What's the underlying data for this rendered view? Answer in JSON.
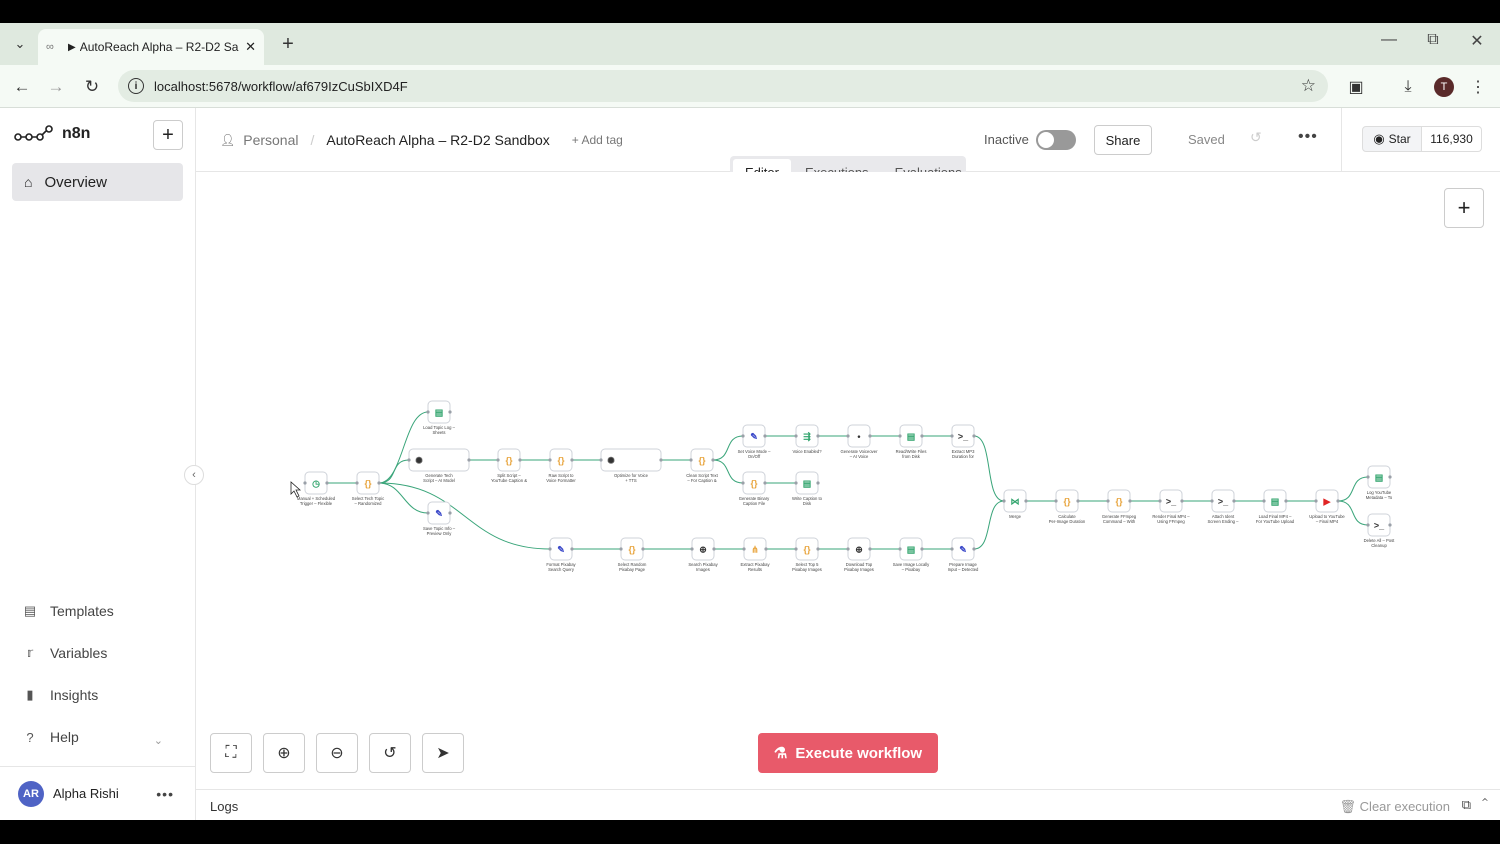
{
  "browser": {
    "tab_title": "AutoReach Alpha – R2-D2 Sa",
    "url": "localhost:5678/workflow/af679IzCuSbIXD4F",
    "profile_initial": "T"
  },
  "sidebar": {
    "brand": "n8n",
    "overview": "Overview",
    "templates": "Templates",
    "variables": "Variables",
    "insights": "Insights",
    "help": "Help",
    "user_name": "Alpha Rishi",
    "user_initials": "AR"
  },
  "header": {
    "project": "Personal",
    "workflow_name": "AutoReach Alpha – R2-D2 Sandbox",
    "add_tag": "+ Add tag",
    "status": "Inactive",
    "share": "Share",
    "saved": "Saved"
  },
  "github": {
    "star": "Star",
    "count": "116,930"
  },
  "view_tabs": [
    "Editor",
    "Executions",
    "Evaluations"
  ],
  "canvas": {
    "execute": "Execute workflow"
  },
  "logs": {
    "label": "Logs",
    "clear": "Clear execution"
  },
  "colors": {
    "accent": "#e85a6a",
    "edge": "#3aa57a",
    "node_border": "#cfd3da"
  },
  "nodes": [
    {
      "id": "trigger",
      "icon": "clock",
      "label": "Manual + Scheduled Trigger – Flexible Timing",
      "color": "#2fa36b"
    },
    {
      "id": "select_topic",
      "icon": "code",
      "label": "Select Tech Topic – Randomized",
      "color": "#e8a33a"
    },
    {
      "id": "load_log",
      "icon": "sheet",
      "label": "Load Topic Log – Sheets",
      "color": "#2fa36b"
    },
    {
      "id": "gen_script",
      "icon": "ai",
      "label": "Generate Tech Script – AI Model",
      "color": "#333333"
    },
    {
      "id": "save_topic",
      "icon": "edit",
      "label": "Save Topic Info – Preview Only",
      "color": "#3b49c9"
    },
    {
      "id": "split_script",
      "icon": "code",
      "label": "Split Script – YouTube Caption & Hashtags",
      "color": "#e8a33a"
    },
    {
      "id": "raw_script",
      "icon": "code",
      "label": "Raw Script to Voice Formatter",
      "color": "#e8a33a"
    },
    {
      "id": "optimize",
      "icon": "ai",
      "label": "Optimize for Voice + TTS",
      "color": "#333333"
    },
    {
      "id": "clean_script",
      "icon": "code",
      "label": "Clean Script Text – For Caption & Voice",
      "color": "#e8a33a"
    },
    {
      "id": "voice_mode",
      "icon": "edit",
      "label": "Set Voice Mode – On/Off",
      "color": "#3b49c9"
    },
    {
      "id": "voice_enabled",
      "icon": "switch",
      "label": "Voice Enabled?",
      "color": "#2fa36b"
    },
    {
      "id": "gen_voice",
      "icon": "dot",
      "label": "Generate Voiceover – AI Voice",
      "color": "#333333"
    },
    {
      "id": "read_wav",
      "icon": "sheet",
      "label": "Read/Write Files from Disk",
      "color": "#2fa36b"
    },
    {
      "id": "extract_mp3",
      "icon": "term",
      "label": "Extract MP3 Duration for Timing Logic",
      "color": "#333333"
    },
    {
      "id": "gen_binary",
      "icon": "code",
      "label": "Generate Binary Caption File",
      "color": "#e8a33a"
    },
    {
      "id": "write_caption",
      "icon": "sheet",
      "label": "Write Caption to Disk",
      "color": "#2fa36b"
    },
    {
      "id": "format_query",
      "icon": "edit",
      "label": "Format Pixabay Search Query",
      "color": "#3b49c9"
    },
    {
      "id": "select_random",
      "icon": "code",
      "label": "Select Random Pixabay Page",
      "color": "#e8a33a"
    },
    {
      "id": "search_pixabay",
      "icon": "globe",
      "label": "Search Pixabay Images",
      "color": "#333333"
    },
    {
      "id": "extract_results",
      "icon": "split",
      "label": "Extract Pixabay Results",
      "color": "#e8a33a"
    },
    {
      "id": "select_top",
      "icon": "code",
      "label": "Select Top 5 Pixabay Images",
      "color": "#e8a33a"
    },
    {
      "id": "download_top",
      "icon": "globe",
      "label": "Download Top Pixabay Images",
      "color": "#333333"
    },
    {
      "id": "save_image",
      "icon": "sheet",
      "label": "Save Image Locally – Pixabay",
      "color": "#2fa36b"
    },
    {
      "id": "prepare_input",
      "icon": "edit",
      "label": "Prepare Image Input – Detected JSON",
      "color": "#3b49c9"
    },
    {
      "id": "merge",
      "icon": "merge",
      "label": "Merge",
      "color": "#2fa36b"
    },
    {
      "id": "calc_duration",
      "icon": "code",
      "label": "Calculate Per-Image Duration + Final MP4",
      "color": "#e8a33a"
    },
    {
      "id": "gen_ffmpeg",
      "icon": "code",
      "label": "Generate FFmpeg Command – With Timing",
      "color": "#e8a33a"
    },
    {
      "id": "render_mp4",
      "icon": "term",
      "label": "Render Final MP4 – Using FFmpeg",
      "color": "#333333"
    },
    {
      "id": "attach_ending",
      "icon": "term",
      "label": "Attach Ident Screen Ending – Final Touch",
      "color": "#333333"
    },
    {
      "id": "load_final",
      "icon": "sheet",
      "label": "Load Final MP4 – For YouTube Upload",
      "color": "#2fa36b"
    },
    {
      "id": "upload_yt",
      "icon": "yt",
      "label": "Upload to YouTube – Final MP4",
      "color": "#e02424"
    },
    {
      "id": "log_yt",
      "icon": "sheet",
      "label": "Log YouTube Metadata – To Sheets",
      "color": "#2fa36b"
    },
    {
      "id": "delete_all",
      "icon": "term",
      "label": "Delete All – Post Cleanup",
      "color": "#333333"
    }
  ]
}
